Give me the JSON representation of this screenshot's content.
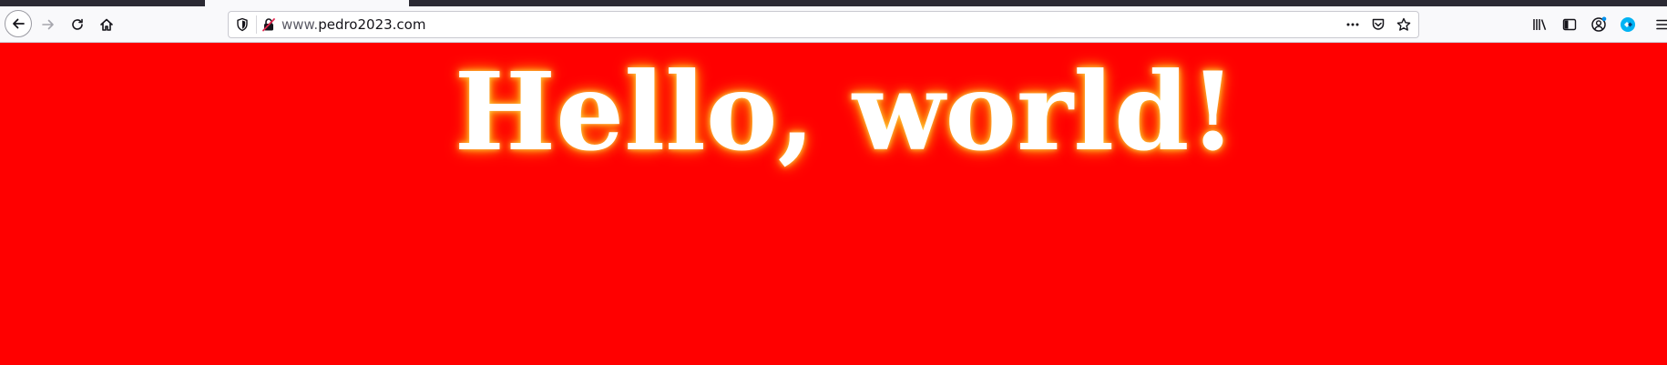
{
  "browser": {
    "url_prefix": "www.",
    "url_main": "pedro2023.com"
  },
  "toolbar_icons": {
    "back": "back-arrow-icon",
    "forward": "forward-arrow-icon",
    "reload": "reload-icon",
    "home": "home-icon",
    "tracking": "shield-icon",
    "insecure": "insecure-lock-icon",
    "page_actions": "more-dots-icon",
    "pocket": "pocket-icon",
    "bookmark": "star-icon",
    "library": "library-icon",
    "sidebar": "sidebar-icon",
    "account": "account-icon",
    "extension": "extension-icon",
    "menu": "hamburger-menu-icon"
  },
  "colors": {
    "page_background": "#ff0000",
    "headline_text": "#ffffff",
    "headline_glow": "#ff9a00"
  },
  "page": {
    "headline": "Hello, world!"
  }
}
